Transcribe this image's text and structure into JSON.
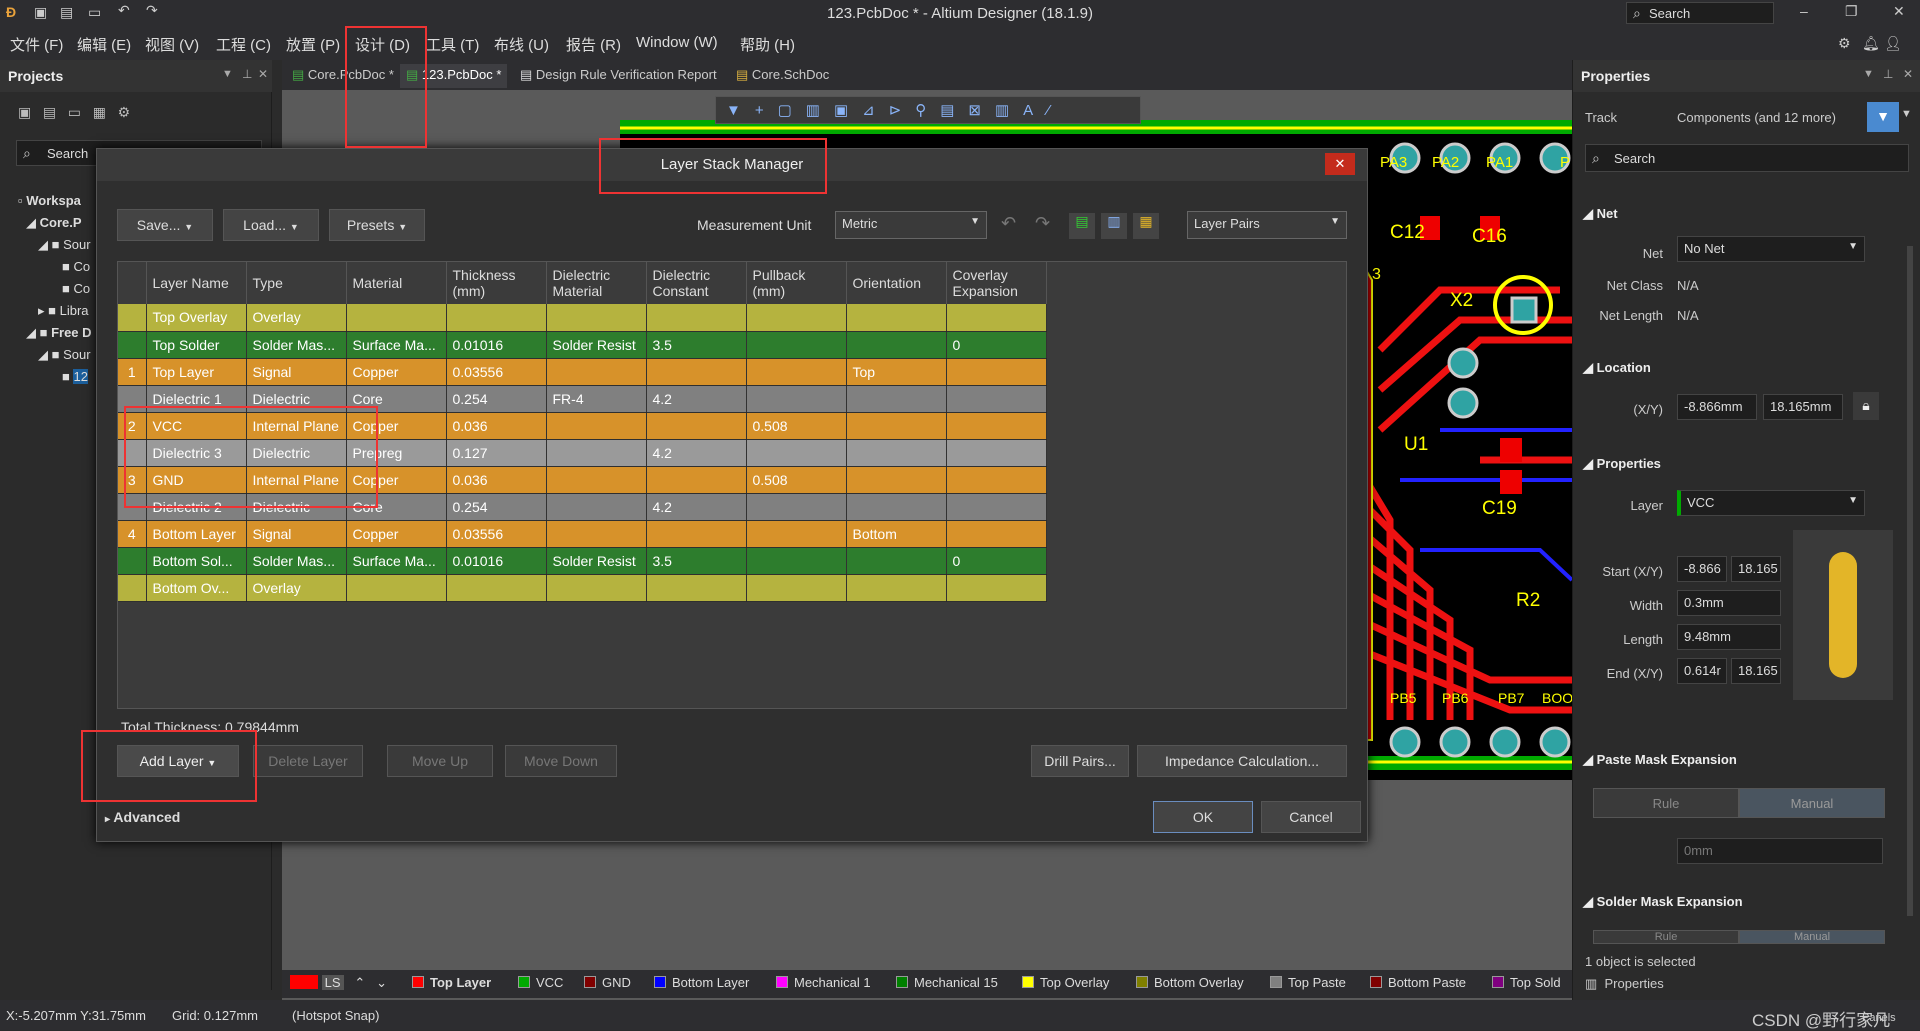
{
  "window": {
    "title": "123.PcbDoc * - Altium Designer (18.1.9)",
    "search_placeholder": "Search"
  },
  "menu": [
    "文件 (F)",
    "编辑 (E)",
    "视图 (V)",
    "工程 (C)",
    "放置 (P)",
    "设计 (D)",
    "工具 (T)",
    "布线 (U)",
    "报告 (R)",
    "Window (W)",
    "帮助 (H)"
  ],
  "projects": {
    "title": "Projects",
    "search": "Search",
    "tree": [
      "Workspa",
      "Core.P",
      "Sour",
      "Co",
      "Co",
      "Libra",
      "Free D",
      "Sour",
      "12"
    ]
  },
  "tabs": [
    "Core.PcbDoc *",
    "123.PcbDoc *",
    "Design Rule Verification Report",
    "Core.SchDoc"
  ],
  "pcb_labels": [
    "PA3",
    "PA2",
    "PA1",
    "P",
    "C12",
    "C16",
    "X2",
    "U1",
    "C19",
    "R2",
    "PB5",
    "PB6",
    "PB7",
    "BOO",
    "3"
  ],
  "dialog": {
    "title": "Layer Stack Manager",
    "save": "Save...",
    "load": "Load...",
    "presets": "Presets",
    "measurement_label": "Measurement Unit",
    "measurement_value": "Metric",
    "layer_pairs": "Layer Pairs",
    "columns": [
      "",
      "Layer Name",
      "Type",
      "Material",
      "Thickness (mm)",
      "Dielectric Material",
      "Dielectric Constant",
      "Pullback (mm)",
      "Orientation",
      "Coverlay Expansion"
    ],
    "rows": [
      {
        "num": "",
        "name": "Top Overlay",
        "type": "Overlay",
        "material": "",
        "thickness": "",
        "diel_mat": "",
        "diel_const": "",
        "pullback": "",
        "orientation": "",
        "coverlay": "",
        "color": "#b5b33f"
      },
      {
        "num": "",
        "name": "Top Solder",
        "type": "Solder Mas...",
        "material": "Surface Ma...",
        "thickness": "0.01016",
        "diel_mat": "Solder Resist",
        "diel_const": "3.5",
        "pullback": "",
        "orientation": "",
        "coverlay": "0",
        "color": "#2d7d2d"
      },
      {
        "num": "1",
        "name": "Top Layer",
        "type": "Signal",
        "material": "Copper",
        "thickness": "0.03556",
        "diel_mat": "",
        "diel_const": "",
        "pullback": "",
        "orientation": "Top",
        "coverlay": "",
        "color": "#d7922a"
      },
      {
        "num": "",
        "name": "Dielectric 1",
        "type": "Dielectric",
        "material": "Core",
        "thickness": "0.254",
        "diel_mat": "FR-4",
        "diel_const": "4.2",
        "pullback": "",
        "orientation": "",
        "coverlay": "",
        "color": "#808080"
      },
      {
        "num": "2",
        "name": "VCC",
        "type": "Internal Plane",
        "material": "Copper",
        "thickness": "0.036",
        "diel_mat": "",
        "diel_const": "",
        "pullback": "0.508",
        "orientation": "",
        "coverlay": "",
        "color": "#d7922a"
      },
      {
        "num": "",
        "name": "Dielectric 3",
        "type": "Dielectric",
        "material": "Prepreg",
        "thickness": "0.127",
        "diel_mat": "",
        "diel_const": "4.2",
        "pullback": "",
        "orientation": "",
        "coverlay": "",
        "color": "#9a9a9a"
      },
      {
        "num": "3",
        "name": "GND",
        "type": "Internal Plane",
        "material": "Copper",
        "thickness": "0.036",
        "diel_mat": "",
        "diel_const": "",
        "pullback": "0.508",
        "orientation": "",
        "coverlay": "",
        "color": "#d7922a"
      },
      {
        "num": "",
        "name": "Dielectric 2",
        "type": "Dielectric",
        "material": "Core",
        "thickness": "0.254",
        "diel_mat": "",
        "diel_const": "4.2",
        "pullback": "",
        "orientation": "",
        "coverlay": "",
        "color": "#808080"
      },
      {
        "num": "4",
        "name": "Bottom Layer",
        "type": "Signal",
        "material": "Copper",
        "thickness": "0.03556",
        "diel_mat": "",
        "diel_const": "",
        "pullback": "",
        "orientation": "Bottom",
        "coverlay": "",
        "color": "#d7922a"
      },
      {
        "num": "",
        "name": "Bottom Sol...",
        "type": "Solder Mas...",
        "material": "Surface Ma...",
        "thickness": "0.01016",
        "diel_mat": "Solder Resist",
        "diel_const": "3.5",
        "pullback": "",
        "orientation": "",
        "coverlay": "0",
        "color": "#2d7d2d"
      },
      {
        "num": "",
        "name": "Bottom Ov...",
        "type": "Overlay",
        "material": "",
        "thickness": "",
        "diel_mat": "",
        "diel_const": "",
        "pullback": "",
        "orientation": "",
        "coverlay": "",
        "color": "#b5b33f"
      }
    ],
    "total_thickness": "Total Thickness: 0.79844mm",
    "add_layer": "Add Layer",
    "delete_layer": "Delete Layer",
    "move_up": "Move Up",
    "move_down": "Move Down",
    "drill_pairs": "Drill Pairs...",
    "impedance": "Impedance Calculation...",
    "advanced": "Advanced",
    "ok": "OK",
    "cancel": "Cancel"
  },
  "properties": {
    "title": "Properties",
    "object": "Track",
    "filter": "Components (and 12 more)",
    "search": "Search",
    "net_section": "Net",
    "net_label": "Net",
    "net_value": "No Net",
    "net_class_label": "Net Class",
    "net_class_value": "N/A",
    "net_length_label": "Net Length",
    "net_length_value": "N/A",
    "location_section": "Location",
    "xy_label": "(X/Y)",
    "x": "-8.866mm",
    "y": "18.165mm",
    "props_section": "Properties",
    "layer_label": "Layer",
    "layer_value": "VCC",
    "start_label": "Start (X/Y)",
    "start_x": "-8.866",
    "start_y": "18.165",
    "width_label": "Width",
    "width_value": "0.3mm",
    "length_label": "Length",
    "length_value": "9.48mm",
    "end_label": "End (X/Y)",
    "end_x": "0.614r",
    "end_y": "18.165",
    "paste_section": "Paste Mask Expansion",
    "rule": "Rule",
    "manual": "Manual",
    "paste_value": "0mm",
    "solder_section": "Solder Mask Expansion",
    "selected": "1 object is selected",
    "footer_tab": "Properties"
  },
  "layer_tabs": [
    {
      "name": "LS",
      "color": "#ff0000"
    },
    {
      "name": "Top Layer",
      "color": "#ff0000"
    },
    {
      "name": "VCC",
      "color": "#00a000"
    },
    {
      "name": "GND",
      "color": "#800000"
    },
    {
      "name": "Bottom Layer",
      "color": "#0000ff"
    },
    {
      "name": "Mechanical 1",
      "color": "#ff00ff"
    },
    {
      "name": "Mechanical 15",
      "color": "#008000"
    },
    {
      "name": "Top Overlay",
      "color": "#ffff00"
    },
    {
      "name": "Bottom Overlay",
      "color": "#808000"
    },
    {
      "name": "Top Paste",
      "color": "#808080"
    },
    {
      "name": "Bottom Paste",
      "color": "#800000"
    },
    {
      "name": "Top Sold",
      "color": "#800080"
    }
  ],
  "status": {
    "coords": "X:-5.207mm Y:31.75mm",
    "grid": "Grid: 0.127mm",
    "snap": "(Hotspot Snap)",
    "watermark": "CSDN @野行家凡",
    "panels": "Panels"
  }
}
